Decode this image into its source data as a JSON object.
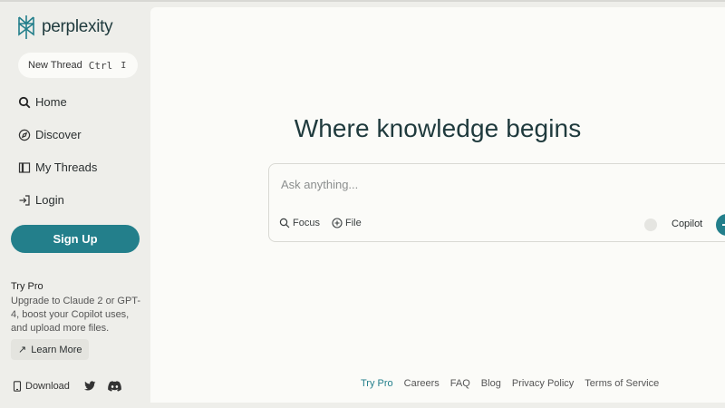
{
  "brand": {
    "name": "perplexity"
  },
  "sidebar": {
    "new_thread": {
      "label": "New Thread",
      "shortcut_key": "Ctrl",
      "shortcut_extra": "I"
    },
    "items": [
      {
        "label": "Home",
        "icon": "search-icon"
      },
      {
        "label": "Discover",
        "icon": "compass-icon"
      },
      {
        "label": "My Threads",
        "icon": "library-icon"
      },
      {
        "label": "Login",
        "icon": "login-icon"
      }
    ],
    "signup_label": "Sign Up",
    "pro": {
      "title": "Try Pro",
      "description": "Upgrade to Claude 2 or GPT-4, boost your Copilot uses, and upload more files.",
      "learn_more": "Learn More"
    },
    "download_label": "Download"
  },
  "main": {
    "headline": "Where knowledge begins",
    "search": {
      "placeholder": "Ask anything...",
      "focus_label": "Focus",
      "file_label": "File",
      "copilot_label": "Copilot"
    },
    "footer": [
      "Try Pro",
      "Careers",
      "FAQ",
      "Blog",
      "Privacy Policy",
      "Terms of Service"
    ]
  },
  "colors": {
    "accent": "#237f8b",
    "sidebar_bg": "#eeeeea",
    "main_bg": "#fbfbf8",
    "title": "#1f3a3d"
  }
}
